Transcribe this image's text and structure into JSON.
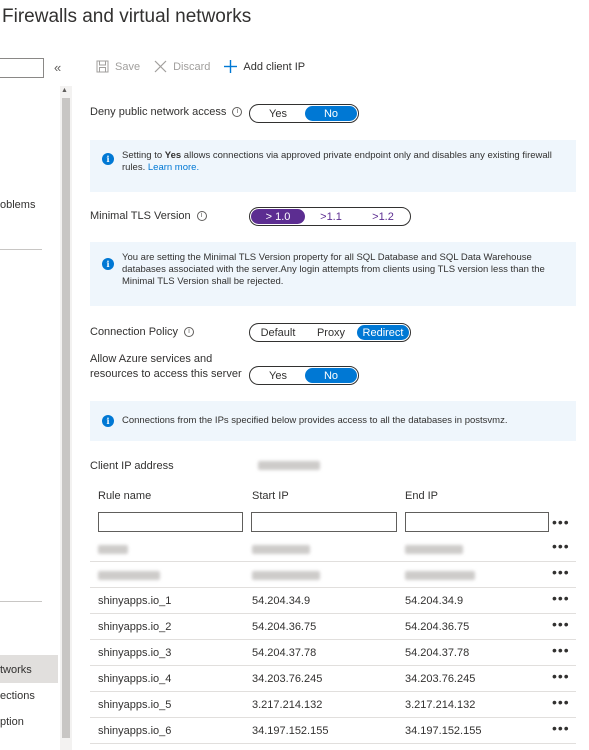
{
  "page": {
    "title": "Firewalls and virtual networks"
  },
  "sidebar": {
    "collapse_glyph": "«",
    "items": [
      {
        "label": "oblems"
      },
      {
        "label": "tworks"
      },
      {
        "label": "ections"
      },
      {
        "label": "ption"
      }
    ]
  },
  "toolbar": {
    "save_label": "Save",
    "discard_label": "Discard",
    "add_client_ip_label": "Add client IP"
  },
  "deny_public": {
    "label": "Deny public network access",
    "options": [
      "Yes",
      "No"
    ],
    "selected": "No"
  },
  "info1": {
    "text_before": "Setting to ",
    "bold": "Yes",
    "text_after": " allows connections via approved private endpoint only and disables any existing firewall rules. ",
    "link": "Learn more."
  },
  "tls": {
    "label": "Minimal TLS Version",
    "options": [
      "> 1.0",
      ">1.1",
      ">1.2"
    ],
    "selected": "> 1.0",
    "accent": "#5c2d91"
  },
  "info2": {
    "text": "You are setting the Minimal TLS Version property for all SQL Database and SQL Data Warehouse databases associated with the server.Any login attempts from clients using TLS version less than the Minimal TLS Version shall be rejected."
  },
  "connection_policy": {
    "label": "Connection Policy",
    "options": [
      "Default",
      "Proxy",
      "Redirect"
    ],
    "selected": "Redirect"
  },
  "allow_azure": {
    "label_line1": "Allow Azure services and",
    "label_line2": "resources to access this server",
    "options": [
      "Yes",
      "No"
    ],
    "selected": "No"
  },
  "info3": {
    "text": "Connections from the IPs specified below provides access to all the databases in postsvmz."
  },
  "client_ip": {
    "label": "Client IP address"
  },
  "rules_table": {
    "columns": [
      "Rule name",
      "Start IP",
      "End IP"
    ],
    "more_glyph": "•••",
    "rows": [
      {
        "name": "shinyapps.io_1",
        "start": "54.204.34.9",
        "end": "54.204.34.9"
      },
      {
        "name": "shinyapps.io_2",
        "start": "54.204.36.75",
        "end": "54.204.36.75"
      },
      {
        "name": "shinyapps.io_3",
        "start": "54.204.37.78",
        "end": "54.204.37.78"
      },
      {
        "name": "shinyapps.io_4",
        "start": "34.203.76.245",
        "end": "34.203.76.245"
      },
      {
        "name": "shinyapps.io_5",
        "start": "3.217.214.132",
        "end": "3.217.214.132"
      },
      {
        "name": "shinyapps.io_6",
        "start": "34.197.152.155",
        "end": "34.197.152.155"
      }
    ]
  },
  "colors": {
    "accent": "#0078d4",
    "info_bg": "#eff6fc",
    "tls_accent": "#5c2d91"
  }
}
